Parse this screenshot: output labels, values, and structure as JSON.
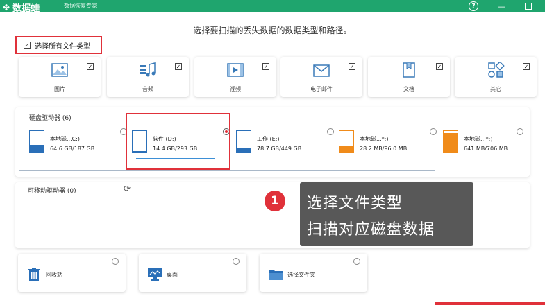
{
  "app": {
    "name": "数据蛙",
    "tagline": "数据恢复专家",
    "help": "?"
  },
  "subtitle": "选择要扫描的丢失数据的数据类型和路径。",
  "select_all": {
    "label": "选择所有文件类型",
    "checked": true
  },
  "file_types": [
    {
      "label": "图片",
      "icon": "image-icon",
      "checked": true
    },
    {
      "label": "音频",
      "icon": "music-icon",
      "checked": true
    },
    {
      "label": "视频",
      "icon": "video-icon",
      "checked": true
    },
    {
      "label": "电子邮件",
      "icon": "mail-icon",
      "checked": true
    },
    {
      "label": "文档",
      "icon": "document-icon",
      "checked": true
    },
    {
      "label": "其它",
      "icon": "other-icon",
      "checked": true
    }
  ],
  "hard_drives": {
    "title": "硬盘驱动器 (6)",
    "drives": [
      {
        "name": "本地磁...C:)",
        "size": "64.6 GB/187 GB",
        "color": "#2a6fb8",
        "used": 0.35,
        "selected": false
      },
      {
        "name": "软件 (D:)",
        "size": "14.4 GB/293 GB",
        "color": "#2a6fb8",
        "used": 0.05,
        "selected": true
      },
      {
        "name": "工作 (E:)",
        "size": "78.7 GB/449 GB",
        "color": "#2a6fb8",
        "used": 0.18,
        "selected": false
      },
      {
        "name": "本地磁...*:)",
        "size": "28.2 MB/96.0 MB",
        "color": "#f08b1a",
        "used": 0.29,
        "selected": false
      },
      {
        "name": "本地磁...*:)",
        "size": "641 MB/706 MB",
        "color": "#f08b1a",
        "used": 0.91,
        "selected": false
      }
    ]
  },
  "removable": {
    "title": "可移动驱动器 (0)"
  },
  "locations": [
    {
      "label": "回收站",
      "icon": "recycle-bin-icon"
    },
    {
      "label": "桌面",
      "icon": "desktop-icon"
    },
    {
      "label": "选择文件夹",
      "icon": "folder-icon"
    }
  ],
  "annotation": {
    "number": "1",
    "line1": "选择文件类型",
    "line2": "扫描对应磁盘数据"
  },
  "colors": {
    "brand": "#1fa56e",
    "highlight": "#e0313a",
    "drive_blue": "#2a6fb8",
    "drive_orange": "#f08b1a"
  }
}
